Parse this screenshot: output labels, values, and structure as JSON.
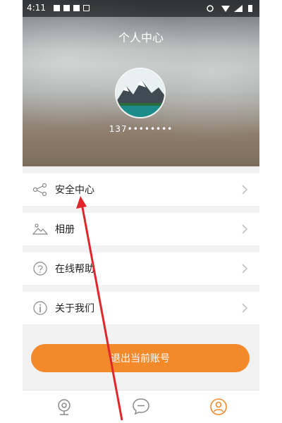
{
  "status_bar": {
    "time": "4:11"
  },
  "header": {
    "title": "个人中心",
    "phone": "137••••••••"
  },
  "menu": {
    "items": [
      {
        "label": "安全中心",
        "icon": "share-nodes-icon"
      },
      {
        "label": "相册",
        "icon": "mountain-image-icon"
      },
      {
        "label": "在线帮助",
        "icon": "question-circle-icon"
      },
      {
        "label": "关于我们",
        "icon": "info-circle-icon"
      }
    ]
  },
  "logout": {
    "label": "退出当前账号"
  },
  "tabbar": {
    "tabs": [
      {
        "icon": "camera-icon"
      },
      {
        "icon": "chat-bubble-icon"
      },
      {
        "icon": "profile-icon",
        "active": true
      }
    ]
  },
  "colors": {
    "accent": "#f28a2b",
    "active_tab": "#f28a2b",
    "inactive_tab": "#888888",
    "arrow": "#e0262a"
  }
}
